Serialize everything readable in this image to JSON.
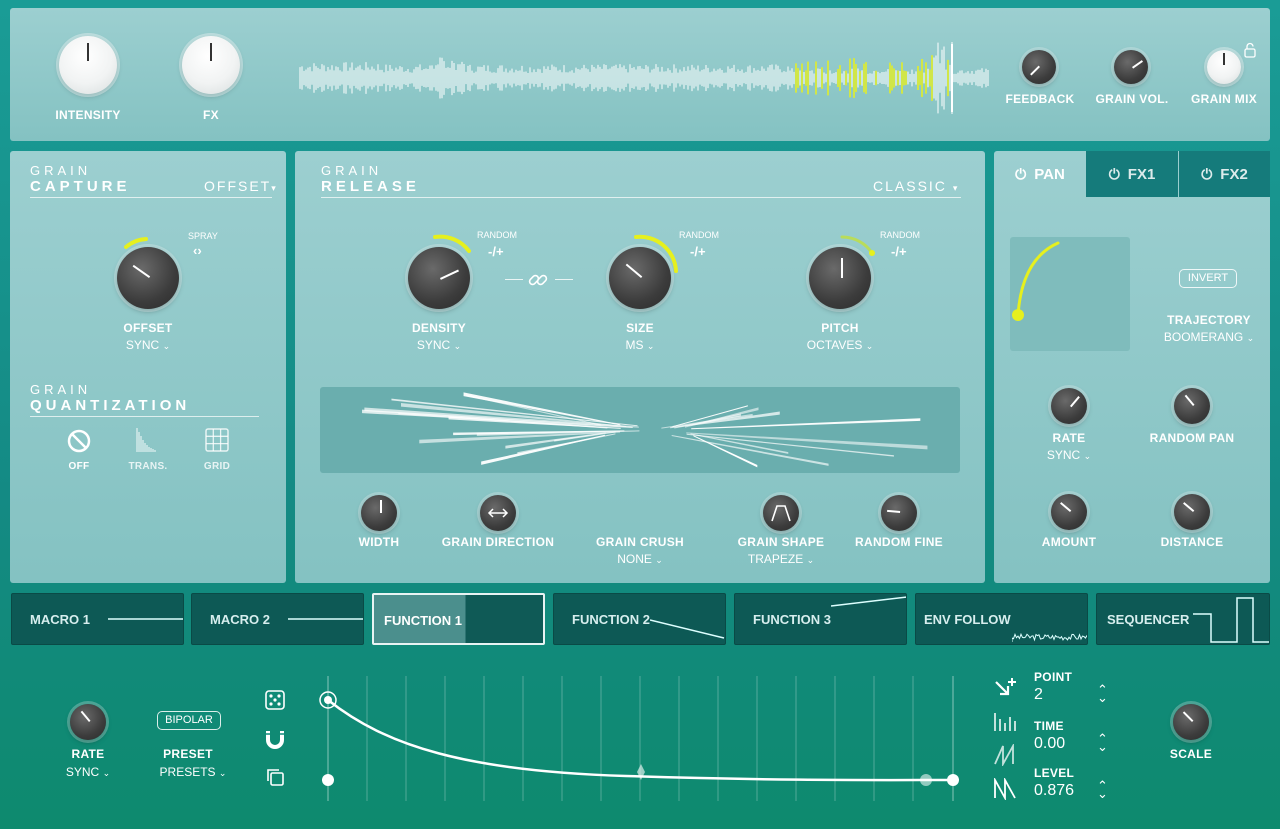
{
  "top": {
    "intensity_label": "INTENSITY",
    "fx_label": "FX",
    "feedback_label": "FEEDBACK",
    "grain_vol_label": "GRAIN VOL.",
    "grain_mix_label": "GRAIN MIX"
  },
  "capture": {
    "title_small": "GRAIN",
    "title_big": "CAPTURE",
    "mode": "OFFSET",
    "spray_label": "SPRAY",
    "offset_label": "OFFSET",
    "offset_sub": "SYNC"
  },
  "quantization": {
    "title_small": "GRAIN",
    "title_big": "QUANTIZATION",
    "items": [
      {
        "label": "OFF",
        "icon": "off-icon"
      },
      {
        "label": "TRANS.",
        "icon": "transient-icon"
      },
      {
        "label": "GRID",
        "icon": "grid-icon"
      }
    ]
  },
  "release": {
    "title_small": "GRAIN",
    "title_big": "RELEASE",
    "mode": "CLASSIC",
    "random_label": "RANDOM",
    "random_value": "-/+",
    "density_label": "DENSITY",
    "density_sub": "SYNC",
    "size_label": "SIZE",
    "size_sub": "MS",
    "pitch_label": "PITCH",
    "pitch_sub": "OCTAVES",
    "width_label": "WIDTH",
    "grain_direction_label": "GRAIN DIRECTION",
    "grain_crush_label": "GRAIN CRUSH",
    "grain_crush_sub": "NONE",
    "grain_shape_label": "GRAIN SHAPE",
    "grain_shape_sub": "TRAPEZE",
    "random_fine_label": "RANDOM FINE"
  },
  "fx_panel": {
    "tabs": [
      "PAN",
      "FX1",
      "FX2"
    ],
    "invert_label": "INVERT",
    "trajectory_label": "TRAJECTORY",
    "trajectory_sub": "BOOMERANG",
    "rate_label": "RATE",
    "rate_sub": "SYNC",
    "random_pan_label": "RANDOM PAN",
    "amount_label": "AMOUNT",
    "distance_label": "DISTANCE"
  },
  "modulators": {
    "tabs": [
      "MACRO 1",
      "MACRO 2",
      "FUNCTION 1",
      "FUNCTION 2",
      "FUNCTION 3",
      "ENV FOLLOW",
      "SEQUENCER"
    ]
  },
  "function_editor": {
    "rate_label": "RATE",
    "rate_sub": "SYNC",
    "bipolar_label": "BIPOLAR",
    "preset_label": "PRESET",
    "preset_sub": "PRESETS",
    "point_label": "POINT",
    "point_value": "2",
    "time_label": "TIME",
    "time_value": "0.00",
    "level_label": "LEVEL",
    "level_value": "0.876",
    "scale_label": "SCALE"
  },
  "colors": {
    "accent": "#e6f01e",
    "panel": "#8fc8c9",
    "dark_tab": "#0d5955"
  }
}
